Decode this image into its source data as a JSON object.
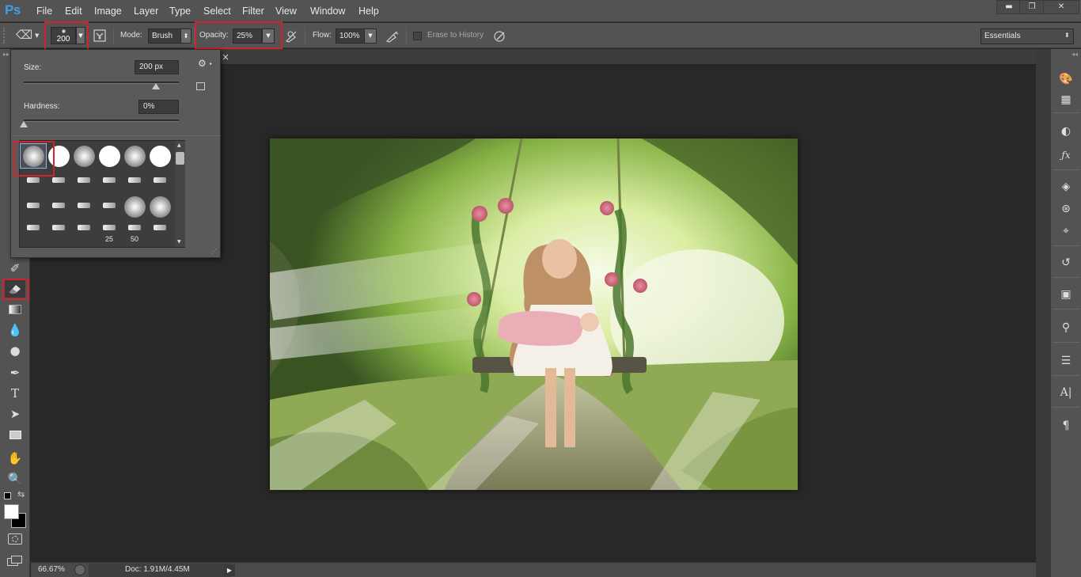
{
  "app": {
    "logo": "Ps"
  },
  "menu": [
    "File",
    "Edit",
    "Image",
    "Layer",
    "Type",
    "Select",
    "Filter",
    "View",
    "Window",
    "Help"
  ],
  "window_controls": {
    "minimize": "▬",
    "restore": "❐",
    "close": "✕"
  },
  "options": {
    "brush_size": "200",
    "mode_label": "Mode:",
    "mode_value": "Brush",
    "opacity_label": "Opacity:",
    "opacity_value": "25%",
    "flow_label": "Flow:",
    "flow_value": "100%",
    "erase_history_label": "Erase to History",
    "workspace": "Essentials"
  },
  "brush_panel": {
    "size_label": "Size:",
    "size_value": "200 px",
    "size_fraction": 0.85,
    "hardness_label": "Hardness:",
    "hardness_value": "0%",
    "hardness_fraction": 0.0,
    "presets": [
      [
        "soft-round",
        "hard-round",
        "soft-round",
        "hard-round",
        "soft-round",
        "hard-round"
      ],
      [
        "stroke",
        "stroke",
        "stroke",
        "stroke",
        "stroke",
        "stroke"
      ],
      [
        "stroke",
        "stroke",
        "stroke",
        "stroke",
        "soft-round",
        "soft-round"
      ],
      [
        "stroke",
        "stroke",
        "stroke",
        "stroke",
        "stroke",
        "stroke"
      ]
    ],
    "preset_numbers": [
      "25",
      "50"
    ],
    "selected_preset": 0
  },
  "document": {
    "close_glyph": "×"
  },
  "status": {
    "zoom": "66.67%",
    "doc": "Doc: 1.91M/4.45M"
  },
  "icons": {
    "tools": [
      "history-brush-icon",
      "eraser-icon",
      "gradient-icon",
      "blur-icon",
      "dodge-icon",
      "pen-icon",
      "type-icon",
      "path-selection-icon",
      "rectangle-icon",
      "hand-icon",
      "zoom-icon"
    ],
    "type_tool_glyph": "T"
  },
  "colors": {
    "accent_red": "#d2232a",
    "ps_blue": "#3aa0e8"
  }
}
